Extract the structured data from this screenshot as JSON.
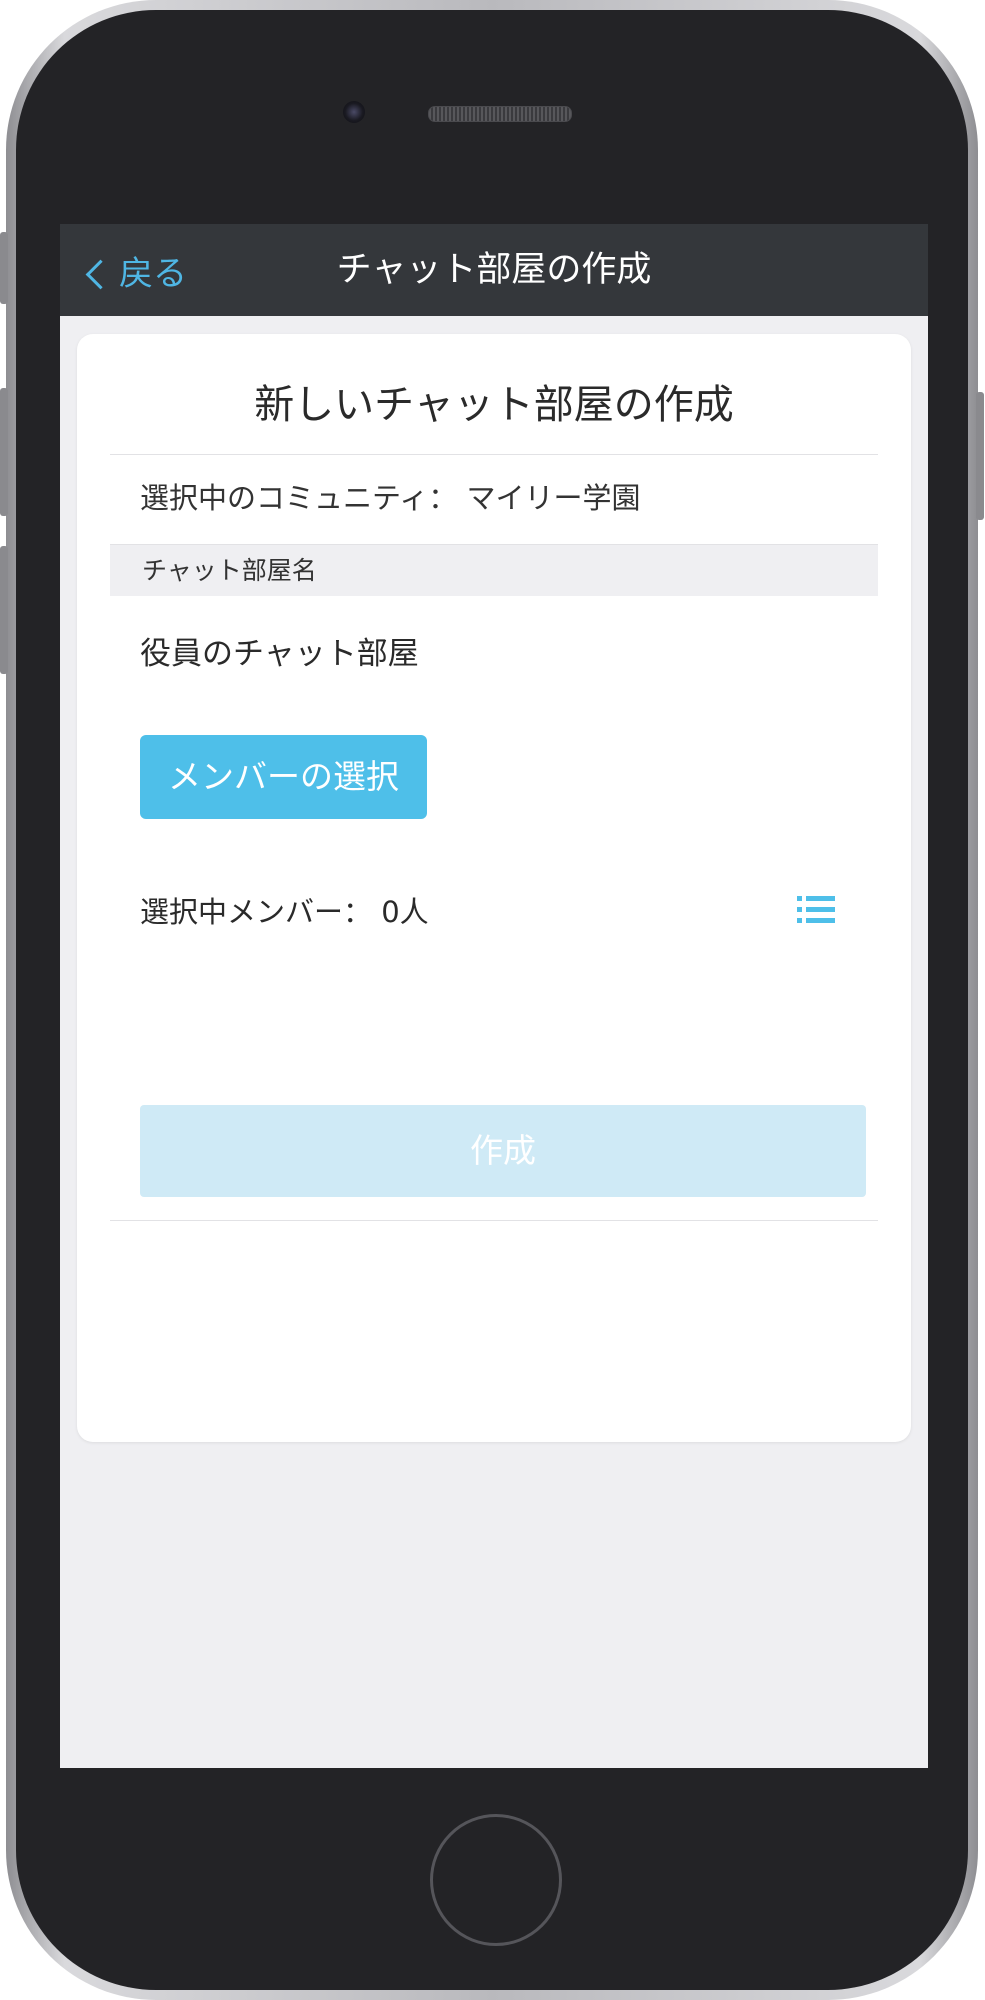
{
  "navbar": {
    "back_label": "戻る",
    "title": "チャット部屋の作成"
  },
  "card": {
    "title": "新しいチャット部屋の作成",
    "community_label": "選択中のコミュニティ：",
    "community_name": "マイリー学園",
    "room_name_header": "チャット部屋名",
    "room_name_value": "役員のチャット部屋",
    "select_members_label": "メンバーの選択",
    "selected_members_label": "選択中メンバー：",
    "selected_members_count": "0人",
    "create_label": "作成"
  },
  "icons": {
    "back": "chevron-left-icon",
    "member_list": "list-icon"
  },
  "colors": {
    "accent": "#4ebfe9",
    "navbar": "#34373b",
    "disabled_button": "#cfeaf6",
    "background": "#efeff2"
  }
}
